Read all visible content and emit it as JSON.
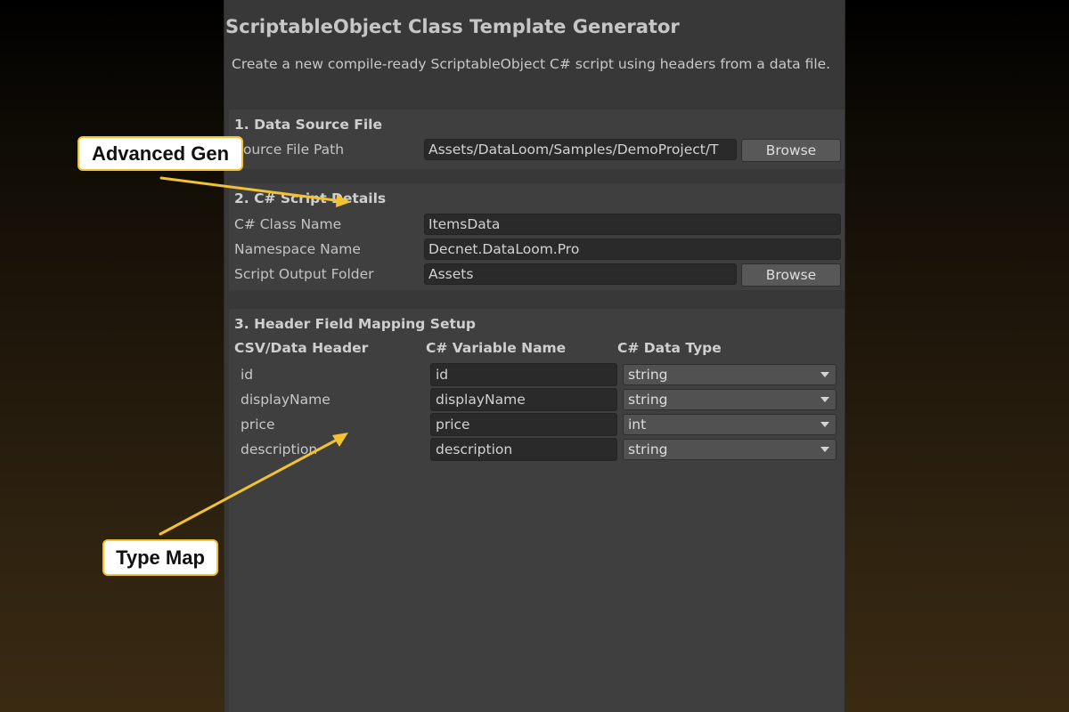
{
  "window": {
    "title": "ScriptableObject Class Template Generator",
    "description": "Create a new compile-ready ScriptableObject C# script using headers from a data file."
  },
  "section1": {
    "title": "1. Data Source File",
    "source_label": "Source File Path",
    "source_value": "Assets/DataLoom/Samples/DemoProject/T",
    "browse_label": "Browse"
  },
  "section2": {
    "title": "2. C# Script Details",
    "class_label": "C# Class Name",
    "class_value": "ItemsData",
    "namespace_label": "Namespace Name",
    "namespace_value": "Decnet.DataLoom.Pro",
    "output_label": "Script Output Folder",
    "output_value": "Assets",
    "browse_label": "Browse"
  },
  "section3": {
    "title": "3. Header Field Mapping Setup",
    "columns": [
      "CSV/Data Header",
      "C# Variable Name",
      "C# Data Type"
    ],
    "rows": [
      {
        "header": "id",
        "variable": "id",
        "type": "string"
      },
      {
        "header": "displayName",
        "variable": "displayName",
        "type": "string"
      },
      {
        "header": "price",
        "variable": "price",
        "type": "int"
      },
      {
        "header": "description",
        "variable": "description",
        "type": "string"
      }
    ]
  },
  "annotations": {
    "advanced_gen": "Advanced Gen",
    "type_map": "Type Map",
    "color": "#f2c230"
  },
  "icons": {
    "dropdown": "chevron-down-icon"
  }
}
